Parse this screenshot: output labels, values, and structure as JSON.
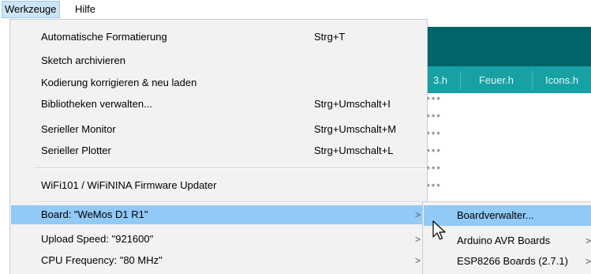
{
  "menubar": {
    "items": [
      "Werkzeuge",
      "Hilfe"
    ]
  },
  "editor": {
    "tabs": [
      "3.h",
      "Feuer.h",
      "Icons.h"
    ],
    "stars": "***"
  },
  "tools_menu": {
    "items": [
      {
        "label": "Automatische Formatierung",
        "shortcut": "Strg+T"
      },
      {
        "label": "Sketch archivieren",
        "shortcut": ""
      },
      {
        "label": "Kodierung korrigieren & neu laden",
        "shortcut": ""
      },
      {
        "label": "Bibliotheken verwalten...",
        "shortcut": "Strg+Umschalt+I"
      },
      {
        "label": "Serieller Monitor",
        "shortcut": "Strg+Umschalt+M"
      },
      {
        "label": "Serieller Plotter",
        "shortcut": "Strg+Umschalt+L"
      },
      {
        "label": "WiFi101 / WiFiNINA Firmware Updater",
        "shortcut": ""
      },
      {
        "label": "Board: \"WeMos D1 R1\"",
        "shortcut": ""
      },
      {
        "label": "Upload Speed: \"921600\"",
        "shortcut": ""
      },
      {
        "label": "CPU Frequency: \"80 MHz\"",
        "shortcut": ""
      }
    ],
    "submenu_arrow": ">"
  },
  "board_submenu": {
    "items": [
      {
        "label": "Boardverwalter..."
      },
      {
        "label": "Arduino AVR Boards"
      },
      {
        "label": "ESP8266 Boards (2.7.1)"
      }
    ],
    "arrow": ">"
  }
}
